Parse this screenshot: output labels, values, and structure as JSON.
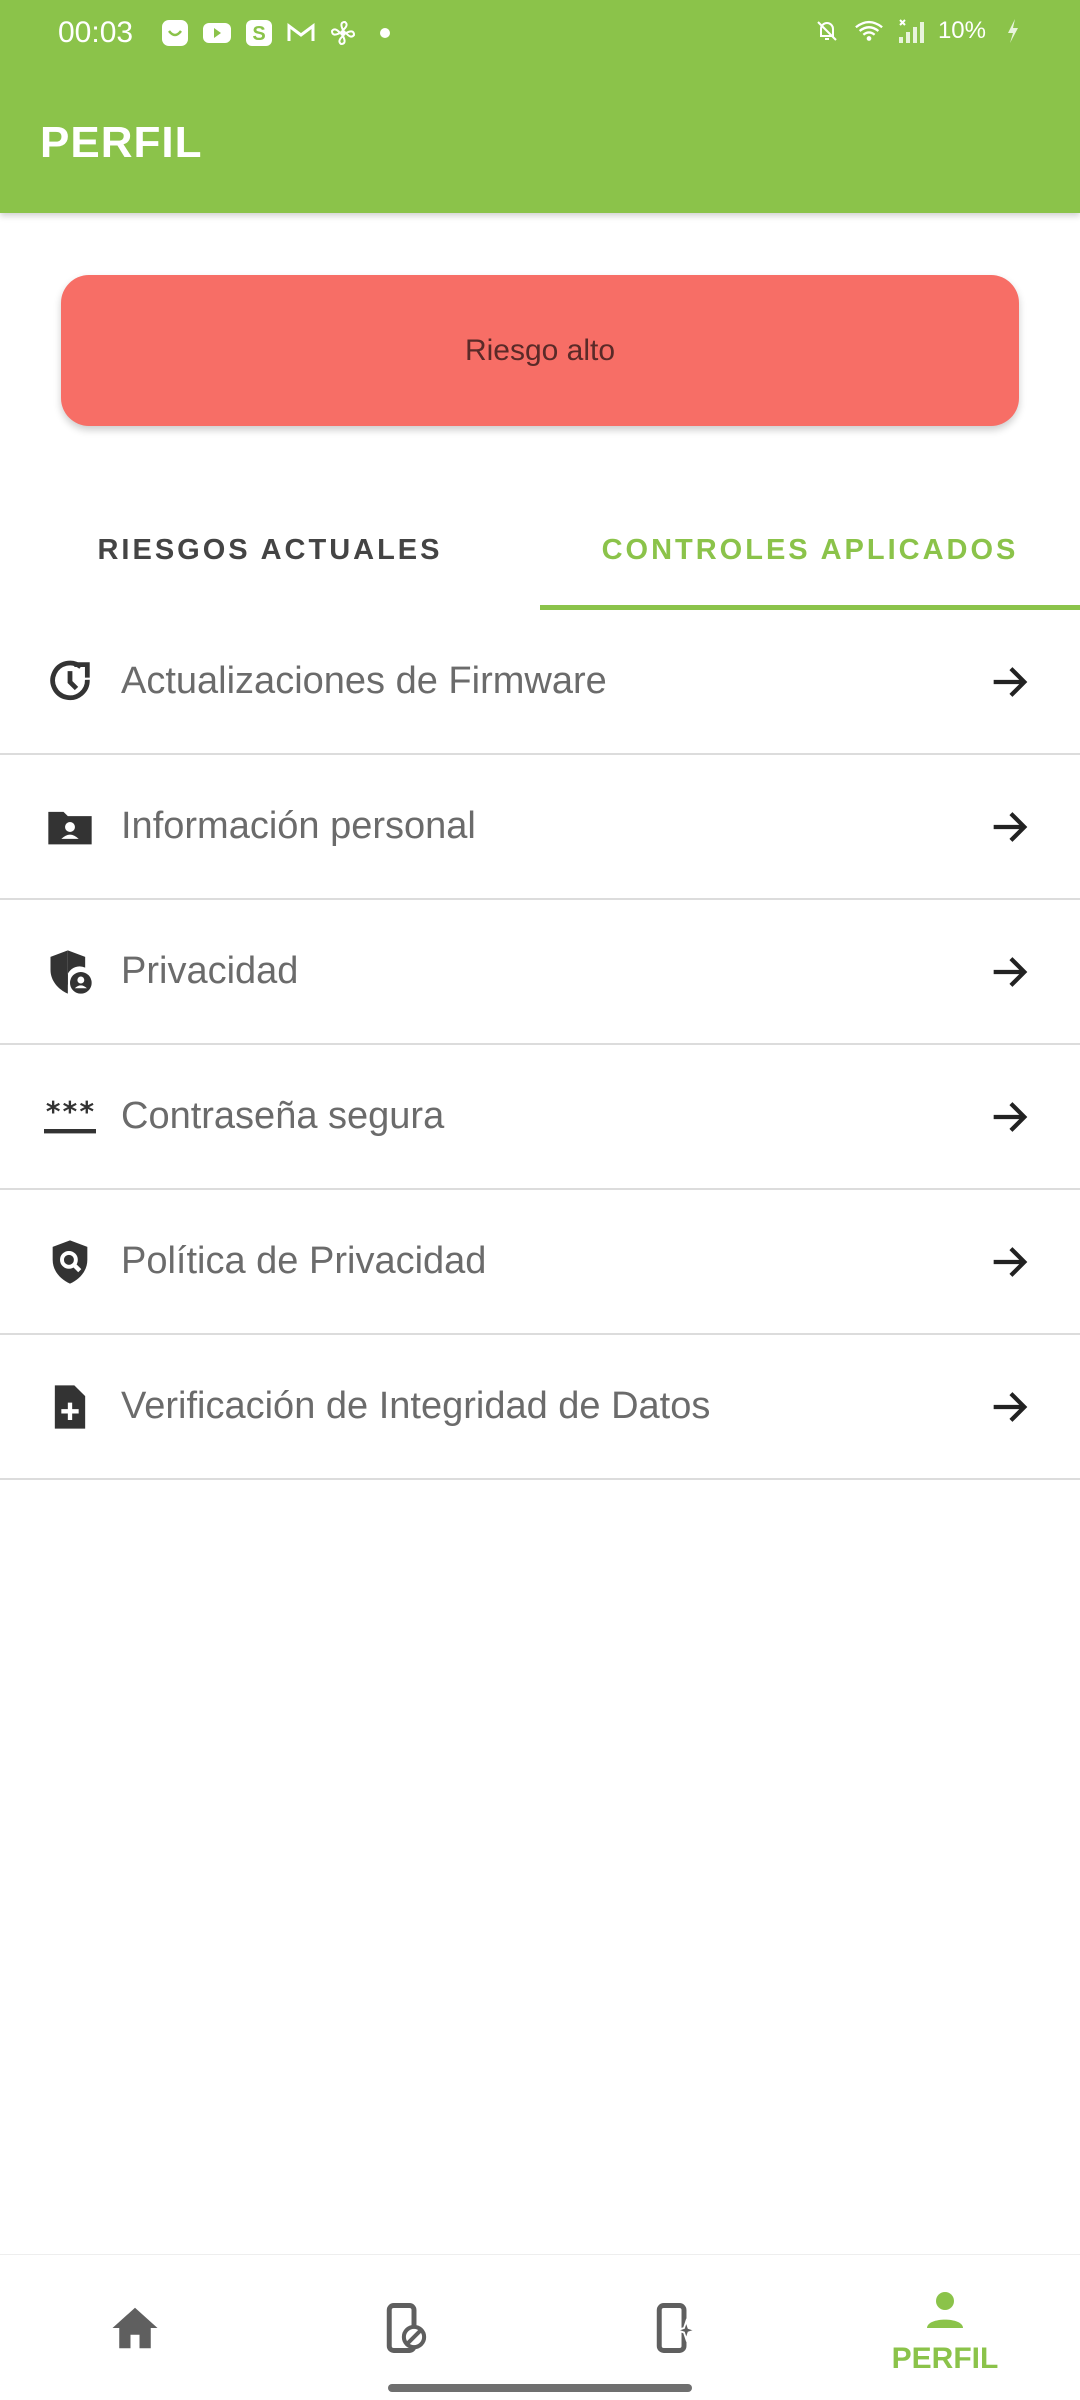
{
  "status_bar": {
    "time": "00:03",
    "battery": "10%",
    "notification_icons": [
      "smile-app-icon",
      "youtube-icon",
      "s-app-icon",
      "gmail-icon",
      "pinwheel-icon",
      "dot-icon"
    ],
    "system_icons": [
      "muted-bell-icon",
      "wifi-icon",
      "signal-icon",
      "battery-charging-icon"
    ]
  },
  "app_bar": {
    "title": "PERFIL"
  },
  "risk_banner": {
    "label": "Riesgo alto",
    "color": "#F76E66"
  },
  "tabs": [
    {
      "label": "RIESGOS ACTUALES",
      "active": false
    },
    {
      "label": "CONTROLES APLICADOS",
      "active": true
    }
  ],
  "list": [
    {
      "label": "Actualizaciones de Firmware",
      "icon": "update-clock-icon"
    },
    {
      "label": "Información personal",
      "icon": "folder-person-icon"
    },
    {
      "label": "Privacidad",
      "icon": "shield-person-icon"
    },
    {
      "label": "Contraseña segura",
      "icon": "password-icon"
    },
    {
      "label": "Política de Privacidad",
      "icon": "shield-search-icon"
    },
    {
      "label": "Verificación de Integridad de Datos",
      "icon": "file-add-icon"
    }
  ],
  "bottom_nav": [
    {
      "icon": "home-icon",
      "label": ""
    },
    {
      "icon": "device-blocked-icon",
      "label": ""
    },
    {
      "icon": "device-sparkle-icon",
      "label": ""
    },
    {
      "icon": "person-icon",
      "label": "PERFIL",
      "active": true
    }
  ],
  "colors": {
    "accent": "#8BC34A",
    "risk": "#F76E66",
    "text": "#6b6b6b"
  }
}
